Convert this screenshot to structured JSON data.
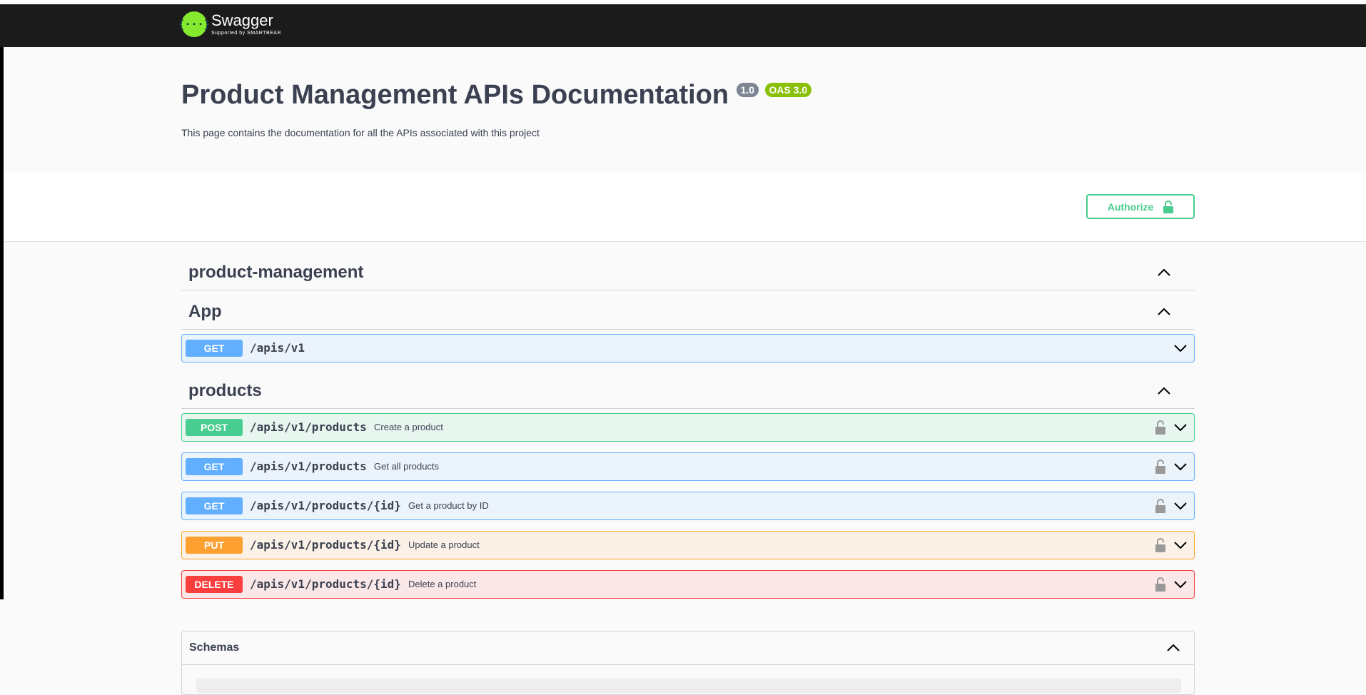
{
  "topbar": {
    "logo_glyph": "{···}",
    "logo_name": "Swagger",
    "logo_sub": "Supported by SMARTBEAR"
  },
  "info": {
    "title": "Product Management APIs Documentation",
    "version_badge": "1.0",
    "oas_badge": "OAS 3.0",
    "description": "This page contains the documentation for all the APIs associated with this project"
  },
  "authorize": {
    "label": "Authorize",
    "icon": "lock-icon"
  },
  "tags": [
    {
      "name": "product-management",
      "expanded": true
    },
    {
      "name": "App",
      "expanded": true
    },
    {
      "name": "products",
      "expanded": true
    }
  ],
  "operations": [
    {
      "method": "GET",
      "path": "/apis/v1",
      "summary": "",
      "locked": false
    },
    {
      "method": "POST",
      "path": "/apis/v1/products",
      "summary": "Create a product",
      "locked": true
    },
    {
      "method": "GET",
      "path": "/apis/v1/products",
      "summary": "Get all products",
      "locked": true
    },
    {
      "method": "GET",
      "path": "/apis/v1/products/{id}",
      "summary": "Get a product by ID",
      "locked": true
    },
    {
      "method": "PUT",
      "path": "/apis/v1/products/{id}",
      "summary": "Update a product",
      "locked": true
    },
    {
      "method": "DELETE",
      "path": "/apis/v1/products/{id}",
      "summary": "Delete a product",
      "locked": true
    }
  ],
  "schemas": {
    "title": "Schemas"
  },
  "colors": {
    "get": "#61affe",
    "post": "#49cc90",
    "put": "#fca130",
    "delete": "#f93e3e",
    "topbar": "#1b1b1b",
    "logo": "#85ea2d"
  }
}
